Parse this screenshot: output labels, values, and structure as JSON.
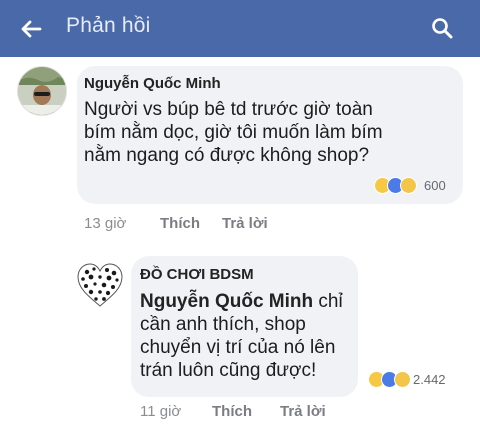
{
  "header": {
    "title": "Phản hồi",
    "icons": {
      "back": "arrow-left-icon",
      "search": "search-icon"
    },
    "background": "#4a69a8"
  },
  "comments": [
    {
      "author": "Nguyễn Quốc Minh",
      "text": "Người vs búp bê td trước giờ toàn bím nằm dọc, giờ tôi muốn làm bím nằm ngang có được không shop?",
      "reaction_count": "600",
      "reaction_icons": [
        "haha-icon",
        "like-icon",
        "sad-icon"
      ],
      "time": "13 giờ",
      "like_label": "Thích",
      "reply_label": "Trả lời"
    },
    {
      "author": "ĐỒ CHƠI BDSM",
      "mention": "Nguyễn Quốc Minh",
      "text": " chỉ cần anh thích, shop chuyển vị trí của nó lên trán luôn cũng được!",
      "reaction_count": "2.442",
      "reaction_icons": [
        "haha-icon",
        "like-icon",
        "sad-icon"
      ],
      "time": "11 giờ",
      "like_label": "Thích",
      "reply_label": "Trả lời"
    }
  ]
}
